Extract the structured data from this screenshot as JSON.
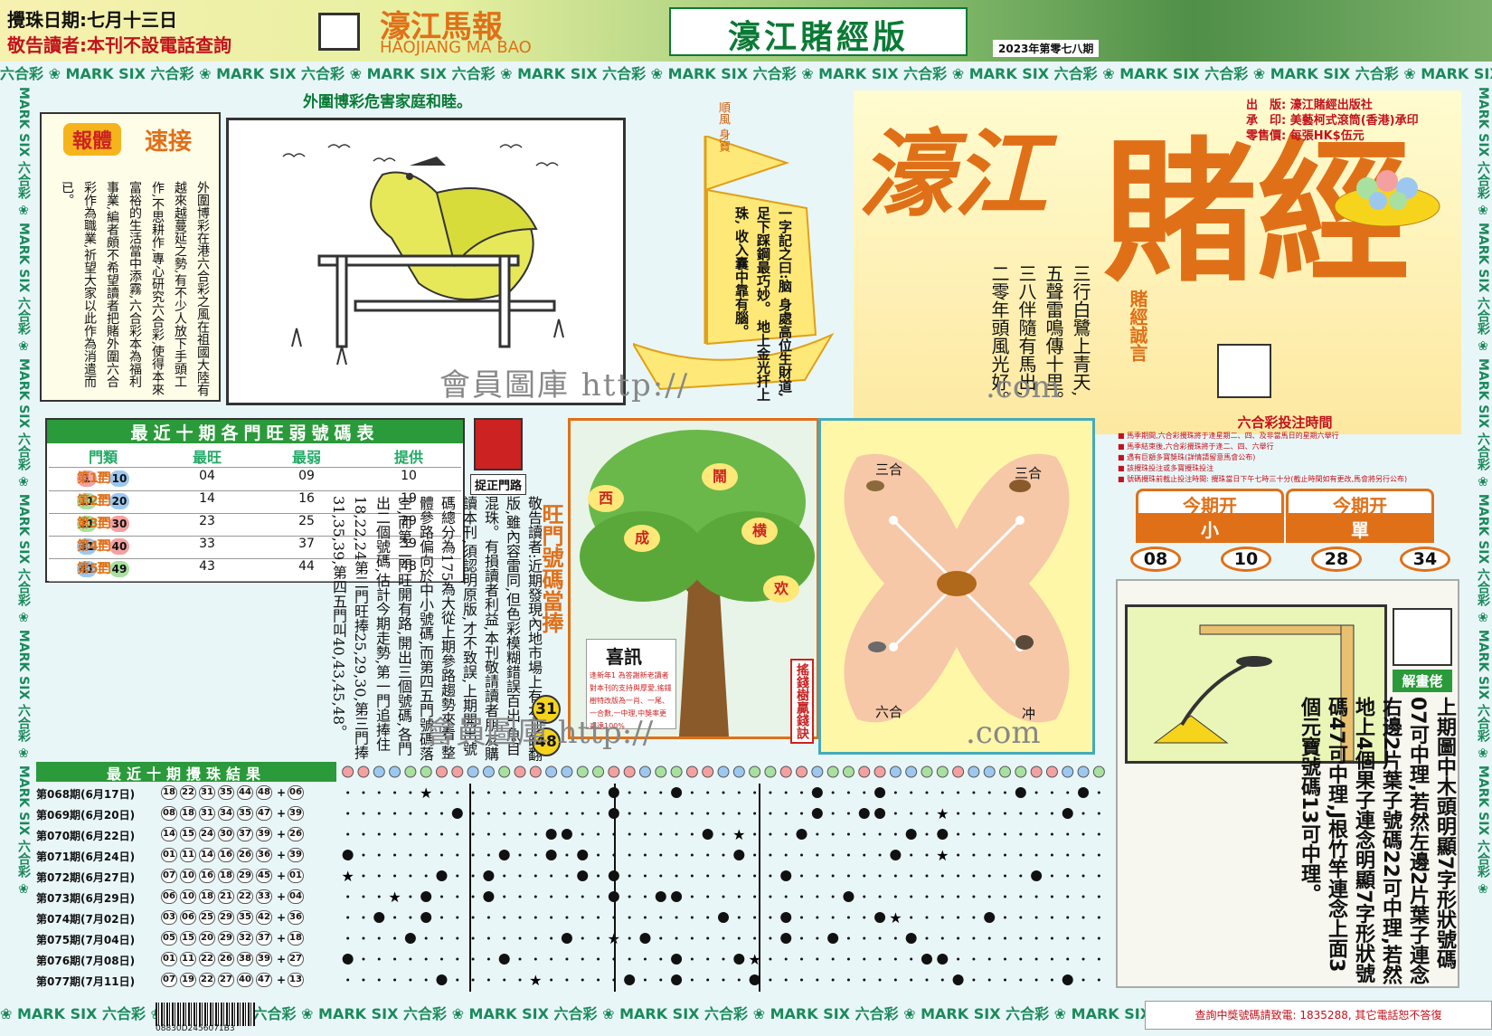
{
  "header": {
    "draw_date": "攪珠日期:七月十三日",
    "notice": "敬告讀者:本刊不設電話查詢",
    "logo_cn": "濠江馬報",
    "logo_en": "HAOJIANG MA BAO",
    "edition_title": "濠江賭經版",
    "issue": "2023年第零七八期"
  },
  "bands": {
    "top": "六合彩 ❀ MARK SIX 六合彩 ❀ MARK SIX 六合彩 ❀ MARK SIX 六合彩 ❀ MARK SIX 六合彩 ❀ MARK SIX 六合彩 ❀ MARK SIX 六合彩 ❀ MARK SIX 六合彩 ❀ MARK SIX 六合彩 ❀ MARK SIX 六合彩 ❀ MARK SIX",
    "bottom": "❀ MARK SIX 六合彩 ❀ MARK SIX 六合彩 ❀ MARK SIX 六合彩 ❀ MARK SIX 六合彩 ❀ MARK SIX 六合彩 ❀ MARK SIX 六合彩 ❀ MARK SIX 六合彩 ❀ MARK SIX",
    "side": "MARK SIX 六合彩 ❀ MARK SIX 六合彩 ❀ MARK SIX 六合彩 ❀ MARK SIX 六合彩 ❀ MARK SIX 六合彩 ❀ MARK SIX 六合彩 ❀"
  },
  "warning": "外圍博彩危害家庭和睦。",
  "article": {
    "tag": "報體",
    "title": "速接",
    "text": "外圍博彩在港六合彩之風在祖國大陸有越來越蔓延之勢,有不少人放下手頭工作,不思耕作,專心研究六合彩,使得本來富裕的生活當中添霧,六合彩本為福利事業,編者頗不希望讀者把賭外圍六合彩作為職業,祈望大家以此作為消遣而已。"
  },
  "watermarks": {
    "w1": "會員圖庫 http://",
    "w2": ".com",
    "w3": "會員圖庫 http://",
    "w4": ".com"
  },
  "sail": {
    "flag": "順風\n身寶",
    "verse": "一字記之曰:脑 身處高位生財道, 足下踩鋼最巧妙。 地上金光扦上珠, 收入囊中靠有腦。"
  },
  "masthead": {
    "he": "濠江",
    "dujing": "賭經",
    "motto": "賭經誠言",
    "publisher_1": "出　版: 濠江賭經出版社",
    "publisher_2": "承　印: 美藝柯式滾筒(香港)承印",
    "publisher_3": "零售價: 每張HK$伍元",
    "poems": "三行白鷺上青天, 五聲雷鳴傳十里。 三八伴隨有馬出, 二零年頭風光好。"
  },
  "betting_time": {
    "title": "六合彩投注時間",
    "items": [
      "■ 馬季期間,六合彩攪珠將于逢星期二、四、及非當馬日的星期六舉行",
      "■ 馬季結束後,六合彩攪珠將于逢二、四、六舉行",
      "■ 遇有巨額多寶獎珠(詳情請留意馬會公布)",
      "■ 該攪珠投注或多寶攪珠投注",
      "■ 號碼攪珠前截止投注時間: 攪珠當日下午七時三十分(截止時間如有更改,馬會將另行公布)"
    ]
  },
  "result": {
    "head": "今期开",
    "values": [
      "小",
      "單"
    ],
    "numbers": [
      "08",
      "10",
      "28",
      "34"
    ]
  },
  "ten_table": {
    "title": "最近十期各門旺弱號碼表",
    "headers": [
      "門類",
      "最旺",
      "最弱",
      "提供"
    ],
    "rows": [
      {
        "door": "第1門",
        "from": "1",
        "to": "10",
        "hot": "04",
        "cold": "09",
        "pick": "10"
      },
      {
        "door": "第2門",
        "from": "11",
        "to": "20",
        "hot": "14",
        "cold": "16",
        "pick": "19"
      },
      {
        "door": "第3門",
        "from": "21",
        "to": "30",
        "hot": "23",
        "cold": "25",
        "pick": "29"
      },
      {
        "door": "第4門",
        "from": "31",
        "to": "40",
        "hot": "33",
        "cold": "37",
        "pick": "39"
      },
      {
        "door": "第5門",
        "from": "41",
        "to": "49",
        "hot": "43",
        "cold": "44",
        "pick": "48"
      }
    ],
    "to_word": "至"
  },
  "goal": {
    "label": "捉正門路"
  },
  "reader_notice": "敬告讀者:近期發現內地市場上有本刊的翻版,雖內容雷同,但色彩模糊錯誤百出,魚目混珠。有損讀者利益,本刊敬請讀者朋友購讀本刊,須認明原版,才不致誤,上期開出號碼總分為175為大從上期參路趨勢來看,整體參路偏向於中小號碼,而第四五門號碼落空,而第二門旺開有路,開出三個號碼,各門出二個號碼,估計今期走勢,第一門追捧住18,22,24第二門旺捧25,29,30,第三門捧31,35,39,第四五門叫40,43,45,48。",
  "wang": {
    "title": "旺門號碼當捧",
    "balls": [
      "31",
      "48"
    ]
  },
  "tree": {
    "label": "搖錢樹贏錢訣",
    "words": [
      "鬧",
      "成",
      "西",
      "横",
      "欢"
    ],
    "xixun_title": "喜訊",
    "xixun_text": "逢新年1 為答謝新老讀者對本刊的支持與厚愛,搖錢樹特改版為一肖、一尾、一合數,一中理,中獎率更高達100%"
  },
  "x_diagram": {
    "labels": [
      "三合",
      "三合",
      "六合",
      "冲"
    ]
  },
  "riddle": {
    "label": "解畫佬",
    "text": "上期圖中木頭明顯7字形狀號碼07可中理,若然左邊2片葉子連念右邊2片葉子號碼22可中理,若然地上4個果子連念明顯7字形狀號碼47可中理,J根竹竿連念上面3個元寶號碼13可中理。"
  },
  "draws": {
    "title": "最近十期攪珠結果",
    "plus": "+",
    "rows": [
      {
        "period": "第068期(6月17日)",
        "nums": [
          "18",
          "22",
          "31",
          "35",
          "44",
          "48"
        ],
        "special": "06"
      },
      {
        "period": "第069期(6月20日)",
        "nums": [
          "08",
          "18",
          "31",
          "34",
          "35",
          "47"
        ],
        "special": "39"
      },
      {
        "period": "第070期(6月22日)",
        "nums": [
          "14",
          "15",
          "24",
          "30",
          "37",
          "39"
        ],
        "special": "26"
      },
      {
        "period": "第071期(6月24日)",
        "nums": [
          "01",
          "11",
          "14",
          "16",
          "26",
          "36"
        ],
        "special": "39"
      },
      {
        "period": "第072期(6月27日)",
        "nums": [
          "07",
          "10",
          "16",
          "18",
          "29",
          "45"
        ],
        "special": "01"
      },
      {
        "period": "第073期(6月29日)",
        "nums": [
          "06",
          "10",
          "18",
          "21",
          "22",
          "33"
        ],
        "special": "04"
      },
      {
        "period": "第074期(7月02日)",
        "nums": [
          "03",
          "06",
          "25",
          "29",
          "35",
          "42"
        ],
        "special": "36"
      },
      {
        "period": "第075期(7月04日)",
        "nums": [
          "05",
          "15",
          "20",
          "29",
          "32",
          "37"
        ],
        "special": "18"
      },
      {
        "period": "第076期(7月08日)",
        "nums": [
          "01",
          "11",
          "22",
          "26",
          "38",
          "39"
        ],
        "special": "27"
      },
      {
        "period": "第077期(7月11日)",
        "nums": [
          "07",
          "19",
          "22",
          "27",
          "40",
          "47"
        ],
        "special": "13"
      }
    ]
  },
  "footer": {
    "barcode_num": "08830D2456071B3",
    "contact": "查詢中獎號碼請致電: 1835288, 其它電話恕不答復"
  },
  "colors": {
    "accent_orange": "#e07018",
    "green": "#2a9a3a",
    "red": "#c2121c",
    "ball_red": "#f4a0a0",
    "ball_blue": "#9cc8f0",
    "ball_green": "#a8e0a0"
  }
}
